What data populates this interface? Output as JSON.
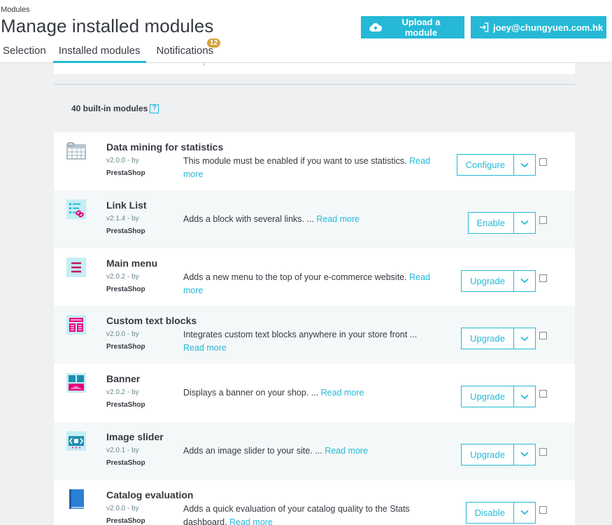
{
  "header": {
    "breadcrumb": "Modules",
    "title": "Manage installed modules",
    "upload_label": "Upload a module",
    "user_label": "joey@chungyuen.com.hk"
  },
  "tabs": [
    {
      "label": "Selection"
    },
    {
      "label": "Installed modules"
    },
    {
      "label": "Notifications",
      "badge": "12"
    }
  ],
  "section": {
    "prev_fragment": ",",
    "title": "40 built-in modules",
    "help": "?"
  },
  "modules": [
    {
      "name": "Data mining for statistics",
      "version": "v2.0.0 - by",
      "author": "PrestaShop",
      "desc": "This module must be enabled if you want to use statistics.",
      "read_more": "Read more",
      "action": "Configure",
      "icon": "data-mining-icon"
    },
    {
      "name": "Link List",
      "version": "v2.1.4 - by",
      "author": "PrestaShop",
      "desc": "Adds a block with several links. ...",
      "read_more": "Read more",
      "action": "Enable",
      "icon": "link-list-icon"
    },
    {
      "name": "Main menu",
      "version": "v2.0.2 - by",
      "author": "PrestaShop",
      "desc": "Adds a new menu to the top of your e-commerce website.",
      "read_more": "Read more",
      "action": "Upgrade",
      "icon": "main-menu-icon"
    },
    {
      "name": "Custom text blocks",
      "version": "v2.0.0 - by",
      "author": "PrestaShop",
      "desc": "Integrates custom text blocks anywhere in your store front ...",
      "read_more": "Read more",
      "action": "Upgrade",
      "icon": "custom-text-icon"
    },
    {
      "name": "Banner",
      "version": "v2.0.2 - by",
      "author": "PrestaShop",
      "desc": "Displays a banner on your shop. ...",
      "read_more": "Read more",
      "action": "Upgrade",
      "icon": "banner-icon"
    },
    {
      "name": "Image slider",
      "version": "v2.0.1 - by",
      "author": "PrestaShop",
      "desc": "Adds an image slider to your site. ...",
      "read_more": "Read more",
      "action": "Upgrade",
      "icon": "image-slider-icon"
    },
    {
      "name": "Catalog evaluation",
      "version": "v2.0.0 - by",
      "author": "PrestaShop",
      "desc": "Adds a quick evaluation of your catalog quality to the Stats dashboard.",
      "read_more": "Read more",
      "action": "Disable",
      "icon": "catalog-evaluation-icon"
    }
  ],
  "colors": {
    "accent": "#25b9d7",
    "badge": "#d6a33a",
    "text": "#363a41"
  }
}
